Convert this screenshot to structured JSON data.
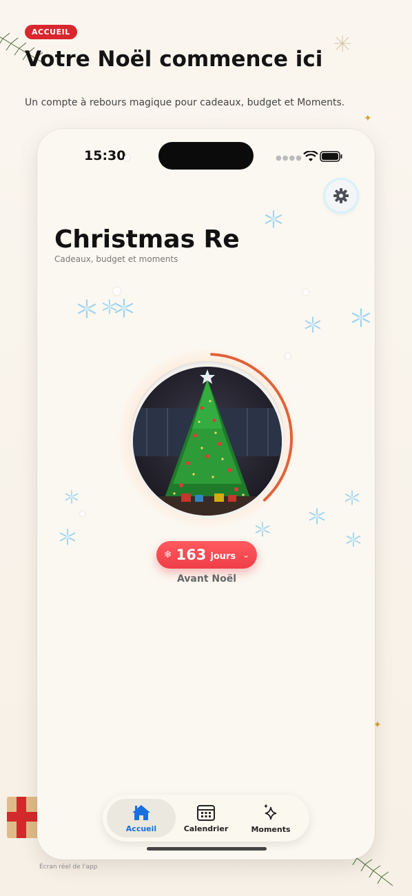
{
  "header": {
    "badge": "ACCUEIL",
    "headline": "Votre Noël commence ici",
    "subtitle": "Un compte à rebours magique pour cadeaux, budget et Moments."
  },
  "status_bar": {
    "time": "15:30"
  },
  "app": {
    "title": "Christmas Re",
    "subtitle": "Cadeaux, budget et moments",
    "settings_icon": "gear-icon"
  },
  "countdown": {
    "value": "163",
    "unit": "jours",
    "label": "Avant Noël",
    "progress_fraction": 0.23
  },
  "tabs": [
    {
      "label": "Accueil",
      "icon": "home-icon",
      "active": true
    },
    {
      "label": "Calendrier",
      "icon": "calendar-icon",
      "active": false
    },
    {
      "label": "Moments",
      "icon": "sparkles-icon",
      "active": false
    }
  ],
  "caption": "Écran réel de l'app",
  "colors": {
    "accent_red": "#ef3e47",
    "badge_red": "#d9262f",
    "active_tab_blue": "#1a6fe0",
    "arc_orange": "#e0623a"
  }
}
